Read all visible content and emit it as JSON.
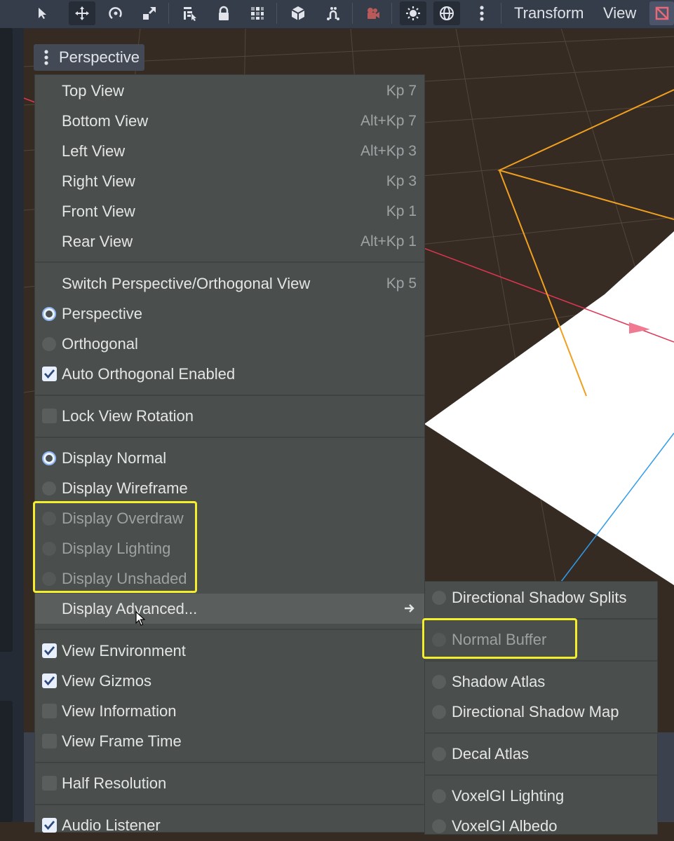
{
  "toolbar": {
    "icons": [
      "select-tool-icon",
      "move-tool-icon",
      "rotate-tool-icon",
      "scale-tool-icon",
      "list-select-icon",
      "lock-icon",
      "group-icon",
      "snap-cube-icon",
      "transform-dots-icon",
      "camera-icon",
      "sun-toggle-icon",
      "environment-globe-icon",
      "more-options-icon"
    ],
    "transform_label": "Transform",
    "view_label": "View"
  },
  "viewport": {
    "perspective_button_label": "Perspective"
  },
  "colors": {
    "menu_bg": "#4a4e4c",
    "highlight": "#f4ee2c",
    "viewport_ground": "#362b22",
    "x_axis": "#e03553",
    "z_axis": "#2f9ae8",
    "gizmo_outline": "#f0a020"
  },
  "view_menu": {
    "view_items": [
      {
        "label": "Top View",
        "shortcut": "Kp 7"
      },
      {
        "label": "Bottom View",
        "shortcut": "Alt+Kp 7"
      },
      {
        "label": "Left View",
        "shortcut": "Alt+Kp 3"
      },
      {
        "label": "Right View",
        "shortcut": "Kp 3"
      },
      {
        "label": "Front View",
        "shortcut": "Kp 1"
      },
      {
        "label": "Rear View",
        "shortcut": "Alt+Kp 1"
      }
    ],
    "switch_view": {
      "label": "Switch Perspective/Orthogonal View",
      "shortcut": "Kp 5"
    },
    "projection": [
      {
        "label": "Perspective",
        "checked": true
      },
      {
        "label": "Orthogonal",
        "checked": false
      }
    ],
    "auto_orthogonal": {
      "label": "Auto Orthogonal Enabled",
      "checked": true
    },
    "lock_rotation": {
      "label": "Lock View Rotation",
      "checked": false
    },
    "display_modes": [
      {
        "label": "Display Normal",
        "checked": true,
        "disabled": false
      },
      {
        "label": "Display Wireframe",
        "checked": false,
        "disabled": false
      },
      {
        "label": "Display Overdraw",
        "checked": false,
        "disabled": true
      },
      {
        "label": "Display Lighting",
        "checked": false,
        "disabled": true
      },
      {
        "label": "Display Unshaded",
        "checked": false,
        "disabled": true
      }
    ],
    "display_advanced": {
      "label": "Display Advanced..."
    },
    "view_toggles": [
      {
        "label": "View Environment",
        "checked": true
      },
      {
        "label": "View Gizmos",
        "checked": true
      },
      {
        "label": "View Information",
        "checked": false
      },
      {
        "label": "View Frame Time",
        "checked": false
      }
    ],
    "half_resolution": {
      "label": "Half Resolution",
      "checked": false
    },
    "audio_listener": {
      "label": "Audio Listener",
      "checked": true
    }
  },
  "advanced_submenu": {
    "items": [
      {
        "label": "Directional Shadow Splits",
        "disabled": false
      },
      {
        "label": "Normal Buffer",
        "disabled": true
      },
      {
        "label": "Shadow Atlas",
        "disabled": false
      },
      {
        "label": "Directional Shadow Map",
        "disabled": false
      },
      {
        "label": "Decal Atlas",
        "disabled": false
      },
      {
        "label": "VoxelGI Lighting",
        "disabled": false
      },
      {
        "label": "VoxelGI Albedo",
        "disabled": false
      }
    ]
  }
}
